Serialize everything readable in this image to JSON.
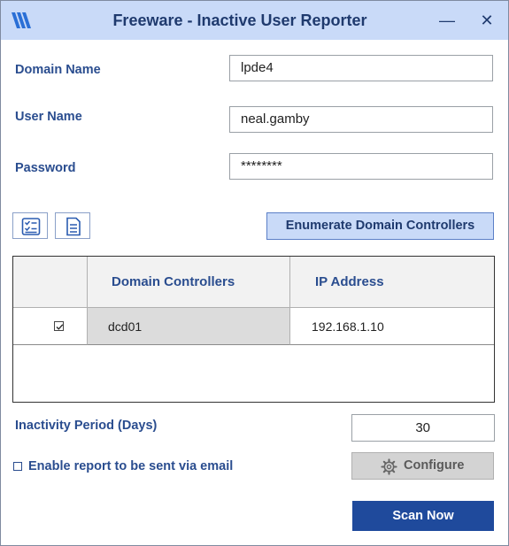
{
  "window": {
    "title": "Freeware - Inactive User Reporter",
    "minimize": "—",
    "close": "✕",
    "colors": {
      "titlebar": "#c9daf8",
      "accent": "#1f4a9c",
      "label": "#2a4d8f"
    }
  },
  "form": {
    "domain_label": "Domain Name",
    "domain_value": "lpde4",
    "user_label": "User Name",
    "user_value": "neal.gamby",
    "password_label": "Password",
    "password_value": "********"
  },
  "toolbar": {
    "checklist_icon": "checklist-icon",
    "document_icon": "document-icon",
    "enumerate_label": "Enumerate Domain Controllers"
  },
  "grid": {
    "columns": [
      "",
      "Domain Controllers",
      "IP Address"
    ],
    "rows": [
      {
        "checked": true,
        "controller": "dcd01",
        "ip": "192.168.1.10"
      }
    ]
  },
  "inactivity": {
    "label": "Inactivity Period (Days)",
    "value": "30"
  },
  "email": {
    "label": "Enable report to be sent via email",
    "checked": false
  },
  "configure": {
    "label": "Configure",
    "icon": "gear-icon"
  },
  "scan": {
    "label": "Scan Now"
  }
}
